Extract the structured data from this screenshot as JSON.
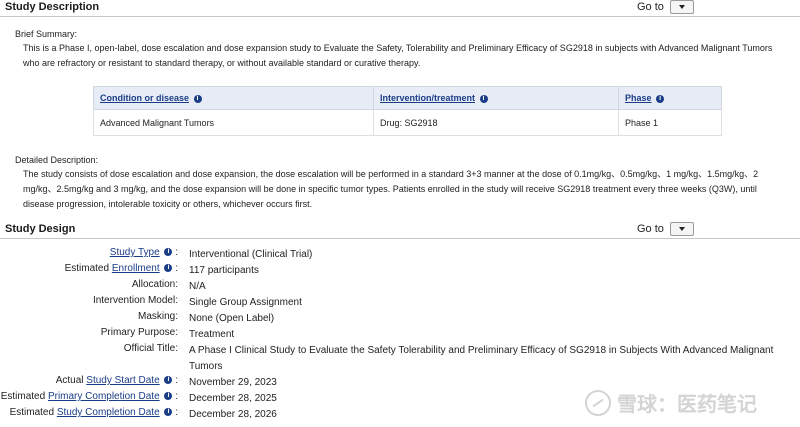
{
  "study_description": {
    "title": "Study Description",
    "goto_label": "Go to",
    "brief_summary_label": "Brief Summary:",
    "brief_summary_line1": "This is a Phase I, open-label, dose escalation and dose expansion study to Evaluate the Safety, Tolerability and Preliminary Efficacy of SG2918 in subjects with Advanced Malignant Tumors",
    "brief_summary_line2": "who are refractory or resistant to standard therapy, or without available standard or curative therapy.",
    "table": {
      "headers": [
        "Condition or disease",
        "Intervention/treatment",
        "Phase"
      ],
      "row": [
        "Advanced Malignant Tumors",
        "Drug: SG2918",
        "Phase 1"
      ]
    },
    "detailed_label": "Detailed Description:",
    "detailed_line1": "The study consists of dose escalation and dose expansion, the dose escalation will be performed in a standard 3+3 manner at the dose of 0.1mg/kg、0.5mg/kg、1 mg/kg、1.5mg/kg、2",
    "detailed_line2": "mg/kg、2.5mg/kg and 3 mg/kg, and the dose expansion will be done in specific tumor types. Patients enrolled in the study will receive SG2918 treatment every three weeks (Q3W), until",
    "detailed_line3": "disease progression, intolerable toxicity or others, whichever occurs first."
  },
  "study_design": {
    "title": "Study Design",
    "goto_label": "Go to",
    "rows": [
      {
        "prefix": "",
        "link": "Study Type",
        "info": true,
        "value": "Interventional  (Clinical Trial)"
      },
      {
        "prefix": "Estimated ",
        "link": "Enrollment",
        "info": true,
        "value": "117 participants"
      },
      {
        "prefix": "Allocation:",
        "link": "",
        "info": false,
        "value": "N/A"
      },
      {
        "prefix": "Intervention Model:",
        "link": "",
        "info": false,
        "value": "Single Group Assignment"
      },
      {
        "prefix": "Masking:",
        "link": "",
        "info": false,
        "value": "None (Open Label)"
      },
      {
        "prefix": "Primary Purpose:",
        "link": "",
        "info": false,
        "value": "Treatment"
      },
      {
        "prefix": "Official Title:",
        "link": "",
        "info": false,
        "value": "A Phase I Clinical Study to Evaluate the Safety Tolerability and Preliminary Efficacy of SG2918 in Subjects With Advanced Malignant",
        "value2": "Tumors"
      },
      {
        "prefix": "Actual ",
        "link": "Study Start Date",
        "info": true,
        "value": "November 29, 2023"
      },
      {
        "prefix": "Estimated ",
        "link": "Primary Completion Date",
        "info": true,
        "value": "December 28, 2025"
      },
      {
        "prefix": "Estimated ",
        "link": "Study Completion Date",
        "info": true,
        "value": "December 28, 2026"
      }
    ]
  },
  "watermark": {
    "text": "雪球：医药笔记",
    "icon": "snowball-logo-icon"
  }
}
